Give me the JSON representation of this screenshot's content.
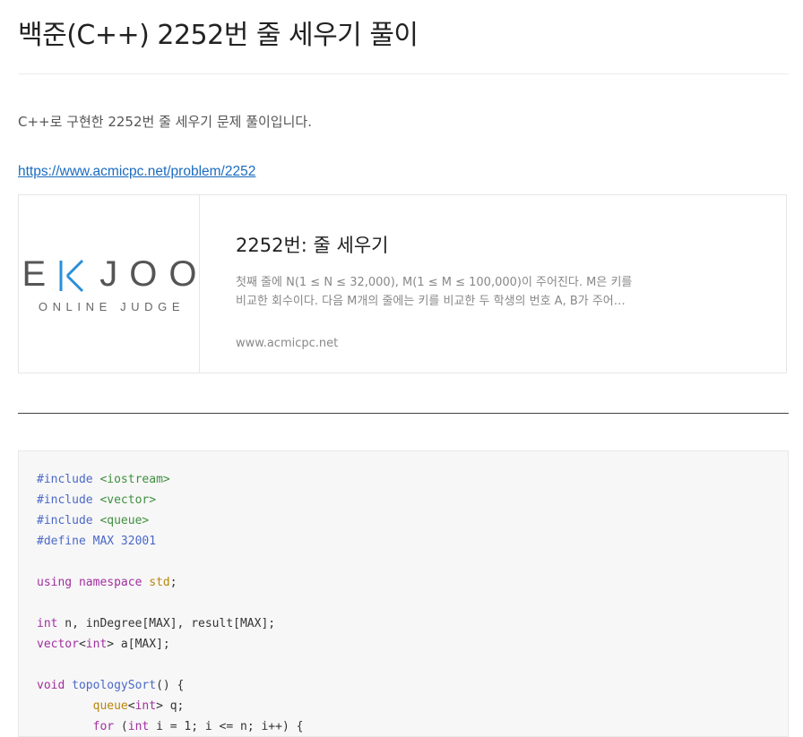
{
  "post": {
    "title": "백준(C++) 2252번 줄 세우기 풀이",
    "intro": "C++로 구현한 2252번 줄 세우기 문제 풀이입니다.",
    "link": "https://www.acmicpc.net/problem/2252"
  },
  "og_card": {
    "logo_main": "EKJOO",
    "logo_sub": "ONLINE JUDGE",
    "logo_accent": "#2a8fd8",
    "title": "2252번: 줄 세우기",
    "desc_line1": "첫째 줄에 N(1 ≤ N ≤ 32,000), M(1 ≤ M ≤ 100,000)이 주어진다. M은 키를",
    "desc_line2": "비교한 회수이다. 다음 M개의 줄에는 키를 비교한 두 학생의 번호 A, B가 주어…",
    "host": "www.acmicpc.net"
  },
  "code": {
    "lines": [
      [
        {
          "t": "#include ",
          "c": "pre"
        },
        {
          "t": "<iostream>",
          "c": "inc"
        }
      ],
      [
        {
          "t": "#include ",
          "c": "pre"
        },
        {
          "t": "<vector>",
          "c": "inc"
        }
      ],
      [
        {
          "t": "#include ",
          "c": "pre"
        },
        {
          "t": "<queue>",
          "c": "inc"
        }
      ],
      [
        {
          "t": "#define MAX 32001",
          "c": "pre"
        }
      ],
      [],
      [
        {
          "t": "using",
          "c": "kw"
        },
        {
          "t": " "
        },
        {
          "t": "namespace",
          "c": "kw"
        },
        {
          "t": " "
        },
        {
          "t": "std",
          "c": "lib"
        },
        {
          "t": ";"
        }
      ],
      [],
      [
        {
          "t": "int",
          "c": "type"
        },
        {
          "t": " n, inDegree[MAX], result[MAX];"
        }
      ],
      [
        {
          "t": "vector",
          "c": "type"
        },
        {
          "t": "<"
        },
        {
          "t": "int",
          "c": "type"
        },
        {
          "t": "> a[MAX];"
        }
      ],
      [],
      [
        {
          "t": "void",
          "c": "type"
        },
        {
          "t": " "
        },
        {
          "t": "topologySort",
          "c": "fn"
        },
        {
          "t": "() {"
        }
      ],
      [
        {
          "t": "        "
        },
        {
          "t": "queue",
          "c": "lib"
        },
        {
          "t": "<"
        },
        {
          "t": "int",
          "c": "type"
        },
        {
          "t": "> q;"
        }
      ],
      [
        {
          "t": "        "
        },
        {
          "t": "for",
          "c": "kw"
        },
        {
          "t": " ("
        },
        {
          "t": "int",
          "c": "type"
        },
        {
          "t": " i = 1; i <= n; i++) {"
        }
      ]
    ]
  }
}
